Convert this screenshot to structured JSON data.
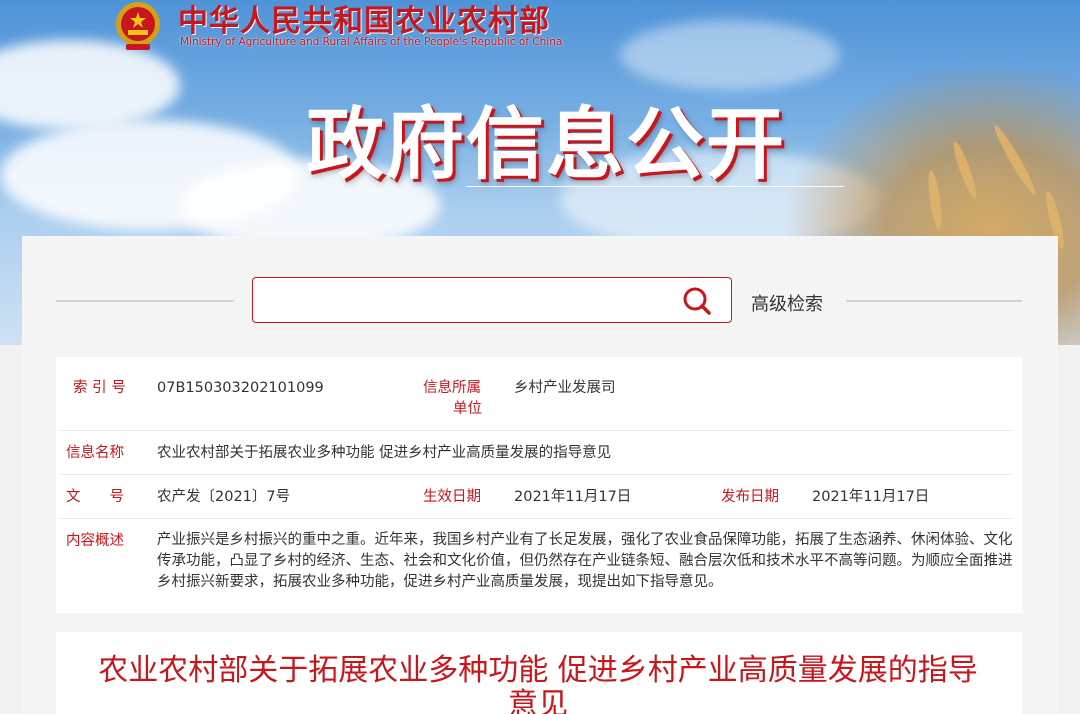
{
  "header": {
    "ministry_cn": "中华人民共和国农业农村部",
    "ministry_en": "Ministry of Agriculture and Rural Affairs of the People's Republic of China",
    "big_title": "政府信息公开"
  },
  "search": {
    "placeholder": "",
    "value": "",
    "advanced_label": "高级检索"
  },
  "info": {
    "index_label": "索 引 号",
    "index_value": "07B150303202101099",
    "unit_label_1": "信息所属",
    "unit_label_2": "单位",
    "unit_value": "乡村产业发展司",
    "name_label": "信息名称",
    "name_value": "农业农村部关于拓展农业多种功能 促进乡村产业高质量发展的指导意见",
    "doc_label": "文　　号",
    "doc_value": "农产发〔2021〕7号",
    "effective_label": "生效日期",
    "effective_value": "2021年11月17日",
    "publish_label": "发布日期",
    "publish_value": "2021年11月17日",
    "summary_label": "内容概述",
    "summary_value": "产业振兴是乡村振兴的重中之重。近年来，我国乡村产业有了长足发展，强化了农业食品保障功能，拓展了生态涵养、休闲体验、文化传承功能，凸显了乡村的经济、生态、社会和文化价值，但仍然存在产业链条短、融合层次低和技术水平不高等问题。为顺应全面推进乡村振兴新要求，拓展农业多种功能，促进乡村产业高质量发展，现提出如下指导意见。"
  },
  "document": {
    "title": "农业农村部关于拓展农业多种功能 促进乡村产业高质量发展的指导意见"
  },
  "colors": {
    "brand_red": "#c8161d",
    "sky_blue": "#78afe3"
  },
  "icons": {
    "emblem": "national-emblem-icon",
    "search": "search-icon"
  }
}
